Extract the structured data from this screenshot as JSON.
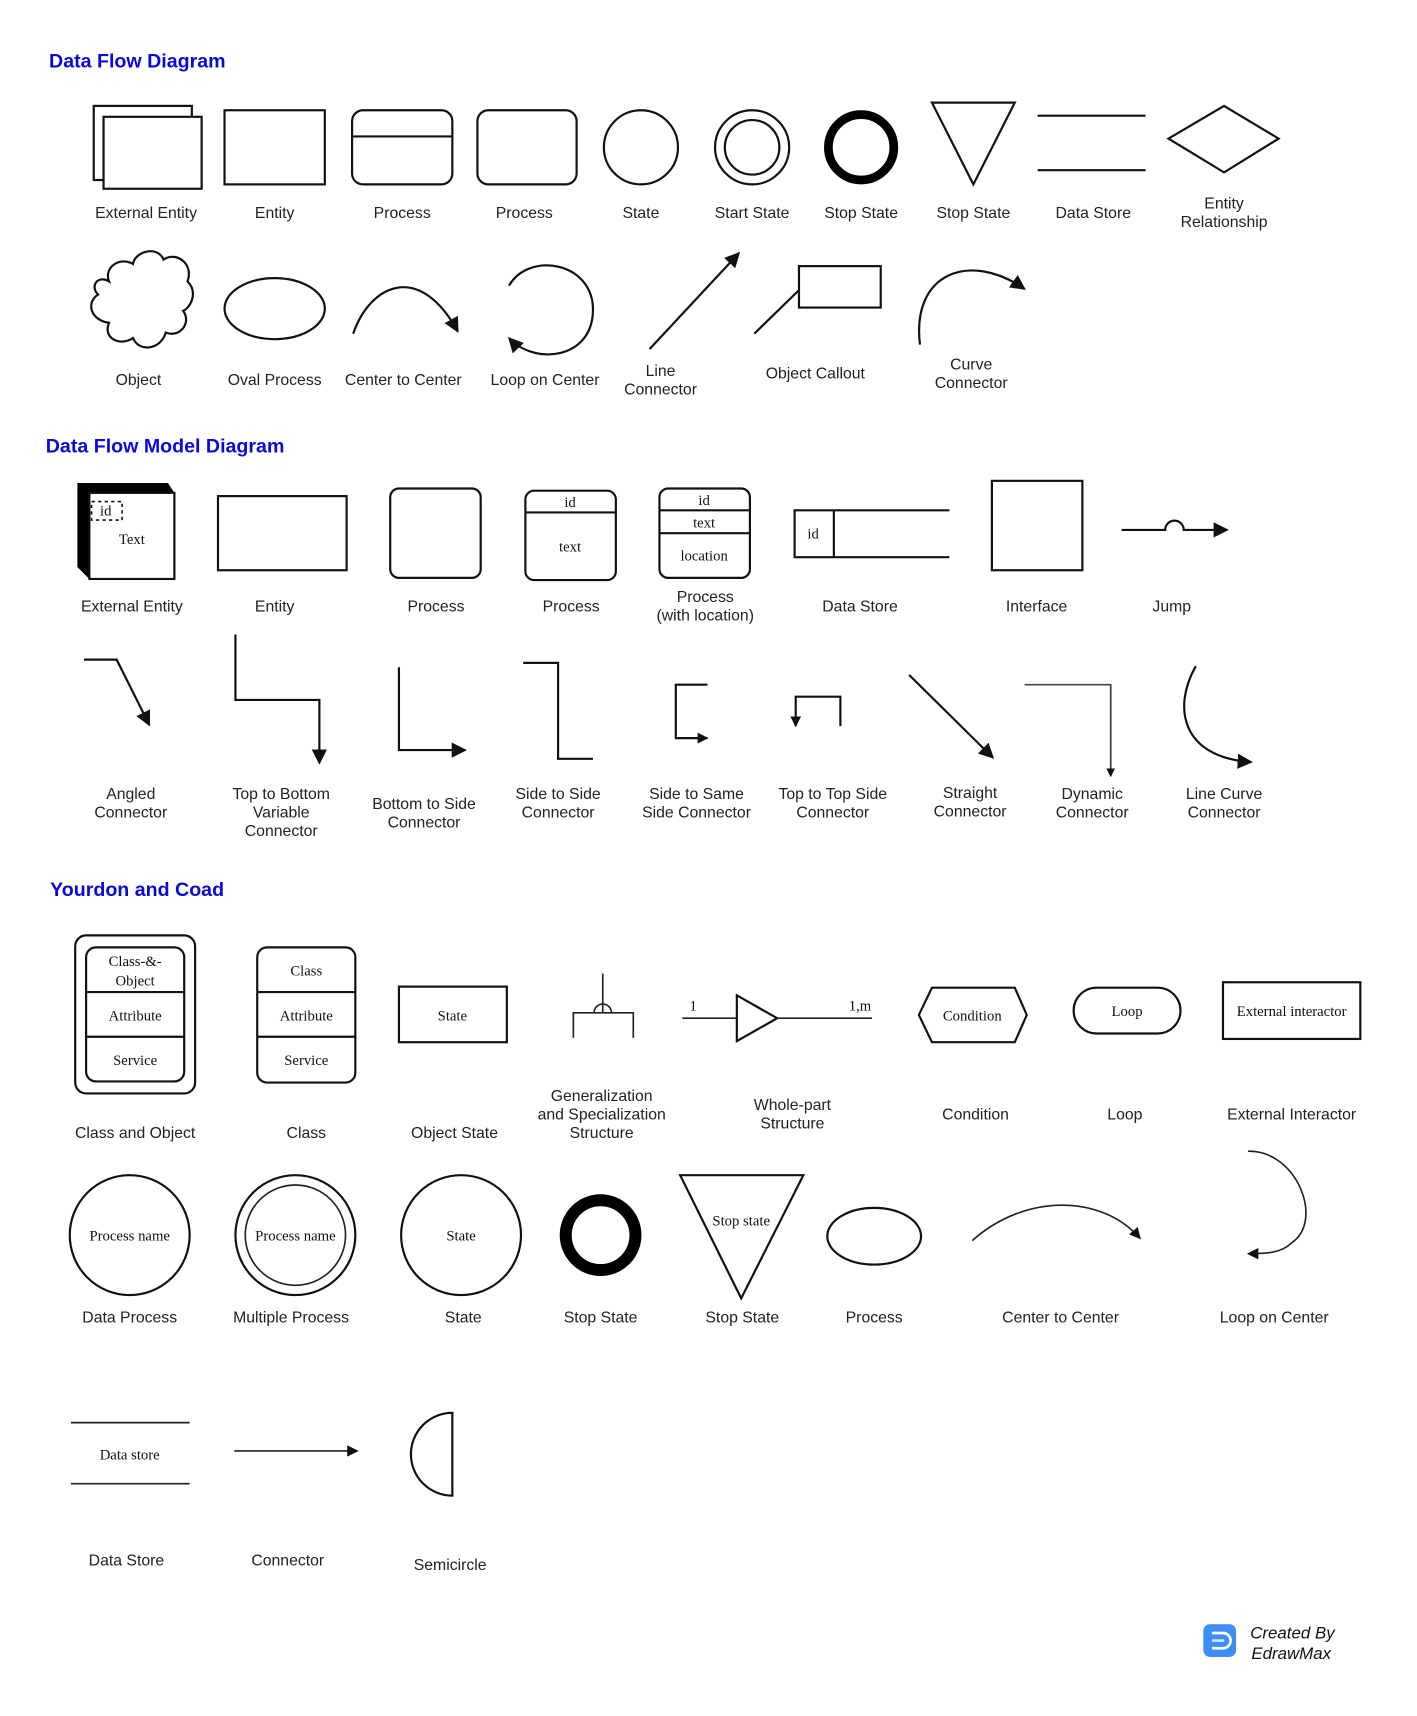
{
  "sections": {
    "dfd": {
      "title": "Data Flow Diagram",
      "row1": [
        "External Entity",
        "Entity",
        "Process",
        "Process",
        "State",
        "Start State",
        "Stop State",
        "Stop State",
        "Data Store",
        [
          "Entity",
          "Relationship"
        ]
      ],
      "row2": [
        "Object",
        "Oval Process",
        "Center to Center",
        "Loop on Center",
        [
          "Line",
          "Connector"
        ],
        "Object Callout",
        [
          "Curve",
          "Connector"
        ]
      ]
    },
    "dfmd": {
      "title": "Data Flow Model Diagram",
      "row1": [
        "External Entity",
        "Entity",
        "Process",
        "Process",
        [
          "Process",
          "(with location)"
        ],
        "Data Store",
        "Interface",
        "Jump"
      ],
      "row1_inner": {
        "ext_id": "id",
        "ext_text": "Text",
        "proc_id": "id",
        "proc_text": "text",
        "procloc_id": "id",
        "procloc_text": "text",
        "procloc_location": "location",
        "store_id": "id"
      },
      "row2": [
        [
          "Angled",
          "Connector"
        ],
        [
          "Top to Bottom",
          "Variable",
          "Connector"
        ],
        [
          "Bottom to Side",
          "Connector"
        ],
        [
          "Side to Side",
          "Connector"
        ],
        [
          "Side to Same",
          "Side Connector"
        ],
        [
          "Top to Top Side",
          "Connector"
        ],
        [
          "Straight",
          "Connector"
        ],
        [
          "Dynamic",
          "Connector"
        ],
        [
          "Line Curve",
          "Connector"
        ]
      ]
    },
    "yc": {
      "title": "Yourdon and Coad",
      "row1": [
        "Class and Object",
        "Class",
        "Object State",
        [
          "Generalization",
          "and Specialization",
          "Structure"
        ],
        [
          "Whole-part",
          "Structure"
        ],
        "Condition",
        "Loop",
        "External Interactor"
      ],
      "row1_inner": {
        "co_title": [
          "Class-&-",
          "Object"
        ],
        "co_attr": "Attribute",
        "co_service": "Service",
        "class_title": "Class",
        "class_attr": "Attribute",
        "class_service": "Service",
        "state": "State",
        "whole_left": "1",
        "whole_right": "1,m",
        "condition": "Condition",
        "loop": "Loop",
        "ext": "External interactor"
      },
      "row2": [
        "Data Process",
        "Multiple Process",
        "State",
        "Stop State",
        "Stop State",
        "Process",
        "Center to Center",
        "Loop on Center"
      ],
      "row2_inner": {
        "dp": "Process name",
        "mp": "Process name",
        "state": "State",
        "stop": "Stop state"
      },
      "row3": [
        "Data Store",
        "Connector",
        "Semicircle"
      ],
      "row3_inner": {
        "store": "Data store"
      }
    }
  },
  "footer": {
    "line1": "Created By",
    "line2": "EdrawMax",
    "logo_color": "#3d8ef5"
  }
}
